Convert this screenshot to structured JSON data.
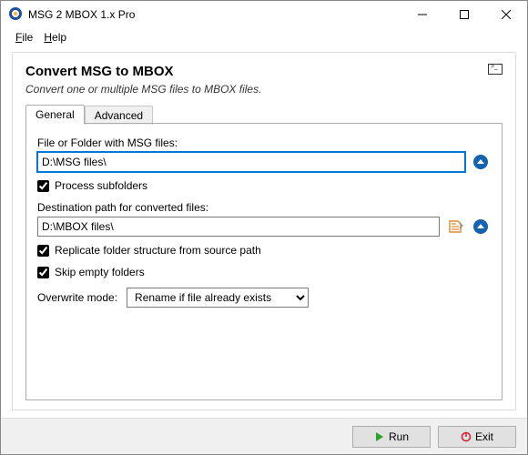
{
  "window": {
    "title": "MSG 2 MBOX 1.x Pro"
  },
  "menu": {
    "file": "File",
    "help": "Help"
  },
  "header": {
    "title": "Convert MSG to MBOX",
    "subtitle": "Convert one or multiple MSG files to MBOX files."
  },
  "tabs": {
    "general": "General",
    "advanced": "Advanced"
  },
  "general": {
    "src_label": "File or Folder with MSG files:",
    "src_value": "D:\\MSG files\\",
    "process_subfolders": "Process subfolders",
    "dst_label": "Destination path for converted files:",
    "dst_value": "D:\\MBOX files\\",
    "replicate": "Replicate folder structure from source path",
    "skip_empty": "Skip empty folders",
    "overwrite_label": "Overwrite mode:",
    "overwrite_value": "Rename if file already exists"
  },
  "footer": {
    "run": "Run",
    "exit": "Exit"
  }
}
